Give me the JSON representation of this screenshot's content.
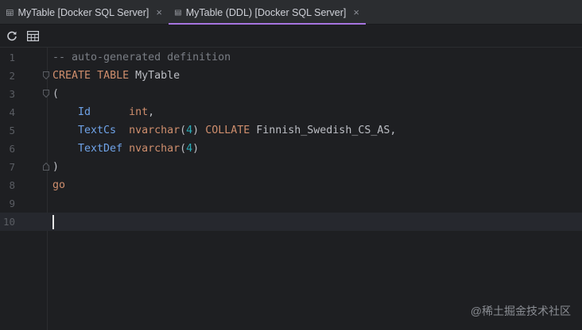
{
  "tabs": [
    {
      "label": "MyTable [Docker SQL Server]",
      "active": false,
      "icon": "table-icon"
    },
    {
      "label": "MyTable (DDL) [Docker SQL Server]",
      "active": true,
      "icon": "table-icon"
    }
  ],
  "tab_close_glyph": "×",
  "toolbar": {
    "buttons": [
      {
        "icon": "refresh-icon"
      },
      {
        "icon": "table-view-icon"
      }
    ]
  },
  "editor": {
    "line_numbers": [
      "1",
      "2",
      "3",
      "4",
      "5",
      "6",
      "7",
      "8",
      "9",
      "10"
    ],
    "lines": [
      {
        "segments": [
          {
            "text": "-- auto-generated definition",
            "kind": "comment"
          }
        ]
      },
      {
        "segments": [
          {
            "text": "CREATE",
            "kind": "keyword"
          },
          {
            "text": " ",
            "kind": "plain"
          },
          {
            "text": "TABLE",
            "kind": "keyword"
          },
          {
            "text": " MyTable",
            "kind": "plain"
          }
        ]
      },
      {
        "segments": [
          {
            "text": "(",
            "kind": "plain"
          }
        ]
      },
      {
        "segments": [
          {
            "text": "    ",
            "kind": "plain"
          },
          {
            "text": "Id",
            "kind": "column"
          },
          {
            "text": "      ",
            "kind": "plain"
          },
          {
            "text": "int",
            "kind": "type"
          },
          {
            "text": ",",
            "kind": "plain"
          }
        ]
      },
      {
        "segments": [
          {
            "text": "    ",
            "kind": "plain"
          },
          {
            "text": "TextCs",
            "kind": "column"
          },
          {
            "text": "  ",
            "kind": "plain"
          },
          {
            "text": "nvarchar",
            "kind": "type"
          },
          {
            "text": "(",
            "kind": "plain"
          },
          {
            "text": "4",
            "kind": "number"
          },
          {
            "text": ") ",
            "kind": "plain"
          },
          {
            "text": "COLLATE",
            "kind": "keyword"
          },
          {
            "text": " Finnish_Swedish_CS_AS,",
            "kind": "plain"
          }
        ]
      },
      {
        "segments": [
          {
            "text": "    ",
            "kind": "plain"
          },
          {
            "text": "TextDef",
            "kind": "column"
          },
          {
            "text": " ",
            "kind": "plain"
          },
          {
            "text": "nvarchar",
            "kind": "type"
          },
          {
            "text": "(",
            "kind": "plain"
          },
          {
            "text": "4",
            "kind": "number"
          },
          {
            "text": ")",
            "kind": "plain"
          }
        ]
      },
      {
        "segments": [
          {
            "text": ")",
            "kind": "plain"
          }
        ]
      },
      {
        "segments": [
          {
            "text": "go",
            "kind": "keyword"
          }
        ]
      },
      {
        "segments": []
      },
      {
        "segments": []
      }
    ],
    "current_line": 10
  },
  "watermark": "@稀土掘金技术社区",
  "colors": {
    "accent": "#a674e0",
    "keyword": "#cf8e6d",
    "comment": "#7a7e85",
    "column": "#6fa3e8",
    "number": "#2aacb8",
    "plain": "#bcbec4"
  }
}
